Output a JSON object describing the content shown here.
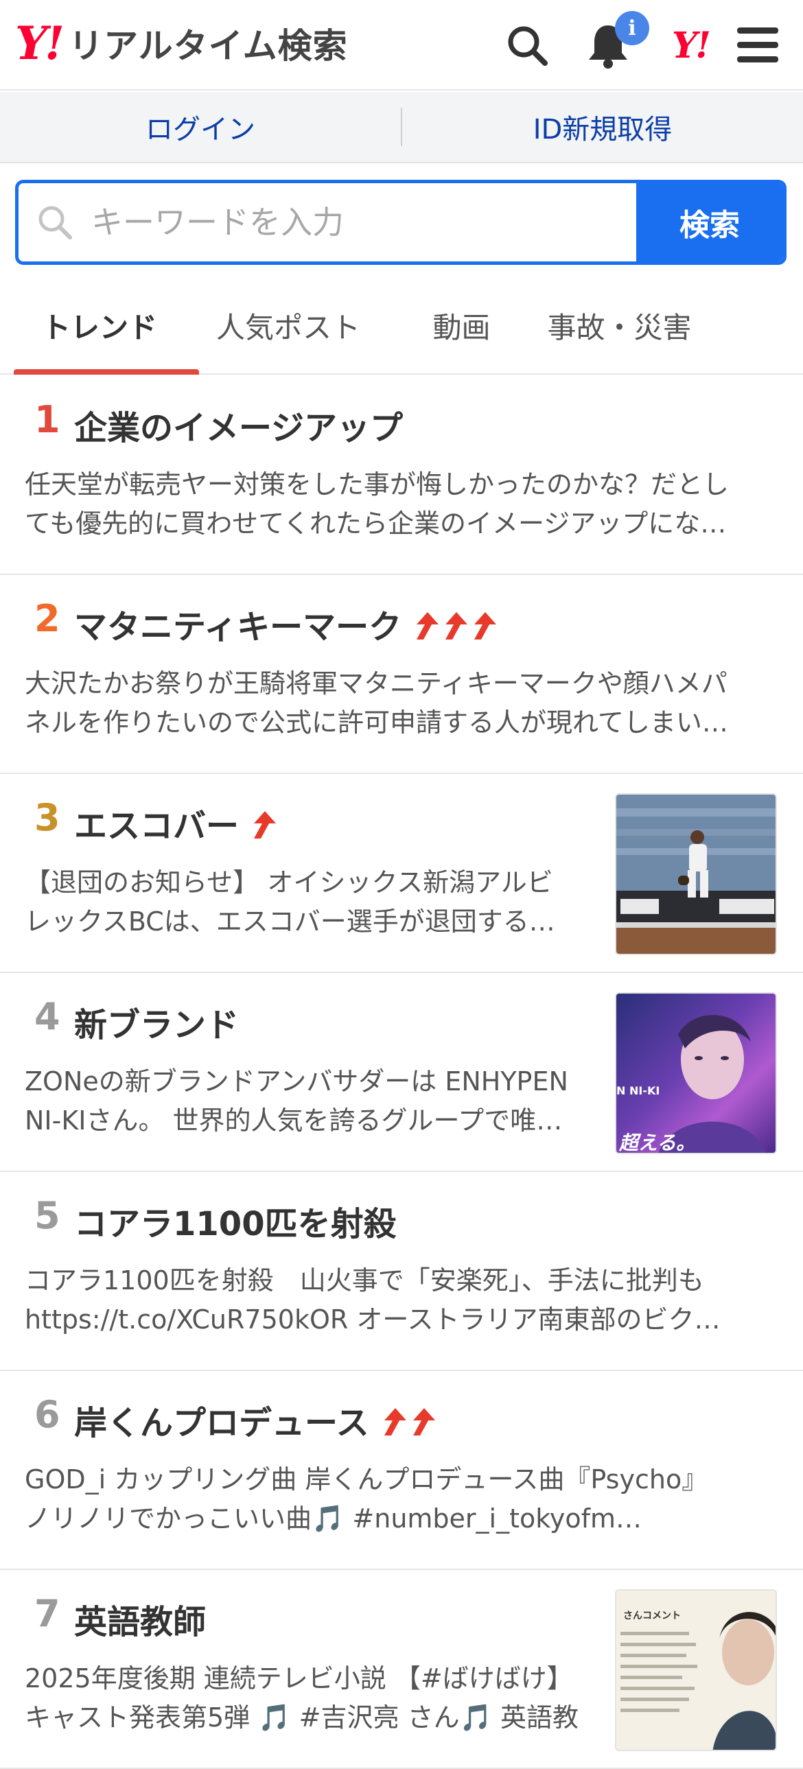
{
  "header": {
    "logo_mark": "Y!",
    "logo_text": "リアルタイム検索",
    "notification_badge": "i",
    "yjapan_mark": "Y!"
  },
  "auth": {
    "login": "ログイン",
    "signup": "ID新規取得"
  },
  "search": {
    "placeholder": "キーワードを入力",
    "button": "検索"
  },
  "tabs": [
    "トレンド",
    "人気ポスト",
    "動画",
    "事故・災害"
  ],
  "colors": {
    "accent_blue": "#1a6ff0",
    "brand_red": "#ff0033",
    "tab_underline": "#e04a3c",
    "rank1": "#e04a3c",
    "rank2": "#f06a2a",
    "rank3": "#c8922a",
    "rank_other": "#9a9a9a",
    "trend_arrow": "#e83a2a"
  },
  "trends": [
    {
      "rank": "1",
      "title": "企業のイメージアップ",
      "arrows": 0,
      "desc1": "任天堂が転売ヤー対策をした事が悔しかったのかな？だとし",
      "desc2": "ても優先的に買わせてくれたら企業のイメージアップにな…",
      "thumb": ""
    },
    {
      "rank": "2",
      "title": "マタニティキーマーク",
      "arrows": 3,
      "desc1": "大沢たかお祭りが王騎将軍マタニティキーマークや顔ハメパ",
      "desc2": "ネルを作りたいので公式に許可申請する人が現れてしまい…",
      "thumb": ""
    },
    {
      "rank": "3",
      "title": "エスコバー",
      "arrows": 1,
      "desc1": "【退団のお知らせ】 オイシックス新潟アルビ",
      "desc2": "レックスBCは、エスコバー選手が退団する…",
      "thumb": "baseball-photo"
    },
    {
      "rank": "4",
      "title": "新ブランド",
      "arrows": 0,
      "desc1": "ZONeの新ブランドアンバサダーは ENHYPEN",
      "desc2": "NI-KIさん。 世界的人気を誇るグループで唯…",
      "thumb": "ambassador-photo"
    },
    {
      "rank": "5",
      "title": "コアラ1100匹を射殺",
      "arrows": 0,
      "desc1": "コアラ1100匹を射殺　山火事で「安楽死」、手法に批判も",
      "desc2": "https://t.co/XCuR750kOR オーストラリア南東部のビク…",
      "thumb": ""
    },
    {
      "rank": "6",
      "title": "岸くんプロデュース",
      "arrows": 2,
      "desc1": "GOD_i カップリング曲 岸くんプロデュース曲『Psycho』",
      "desc2": "ノリノリでかっこいい曲🎵 #number_i_tokyofm…",
      "thumb": ""
    },
    {
      "rank": "7",
      "title": "英語教師",
      "arrows": 0,
      "desc1": "2025年度後期 連続テレビ小説 【#ばけばけ】",
      "desc2": "キャスト発表第5弾 🎵 #吉沢亮 さん🎵 英語教…",
      "thumb": "drama-photo"
    }
  ],
  "thumb_texts": {
    "ambassador_caption": "超える。",
    "ambassador_name": "N NI-KI",
    "drama_caption": "さんコメント"
  }
}
